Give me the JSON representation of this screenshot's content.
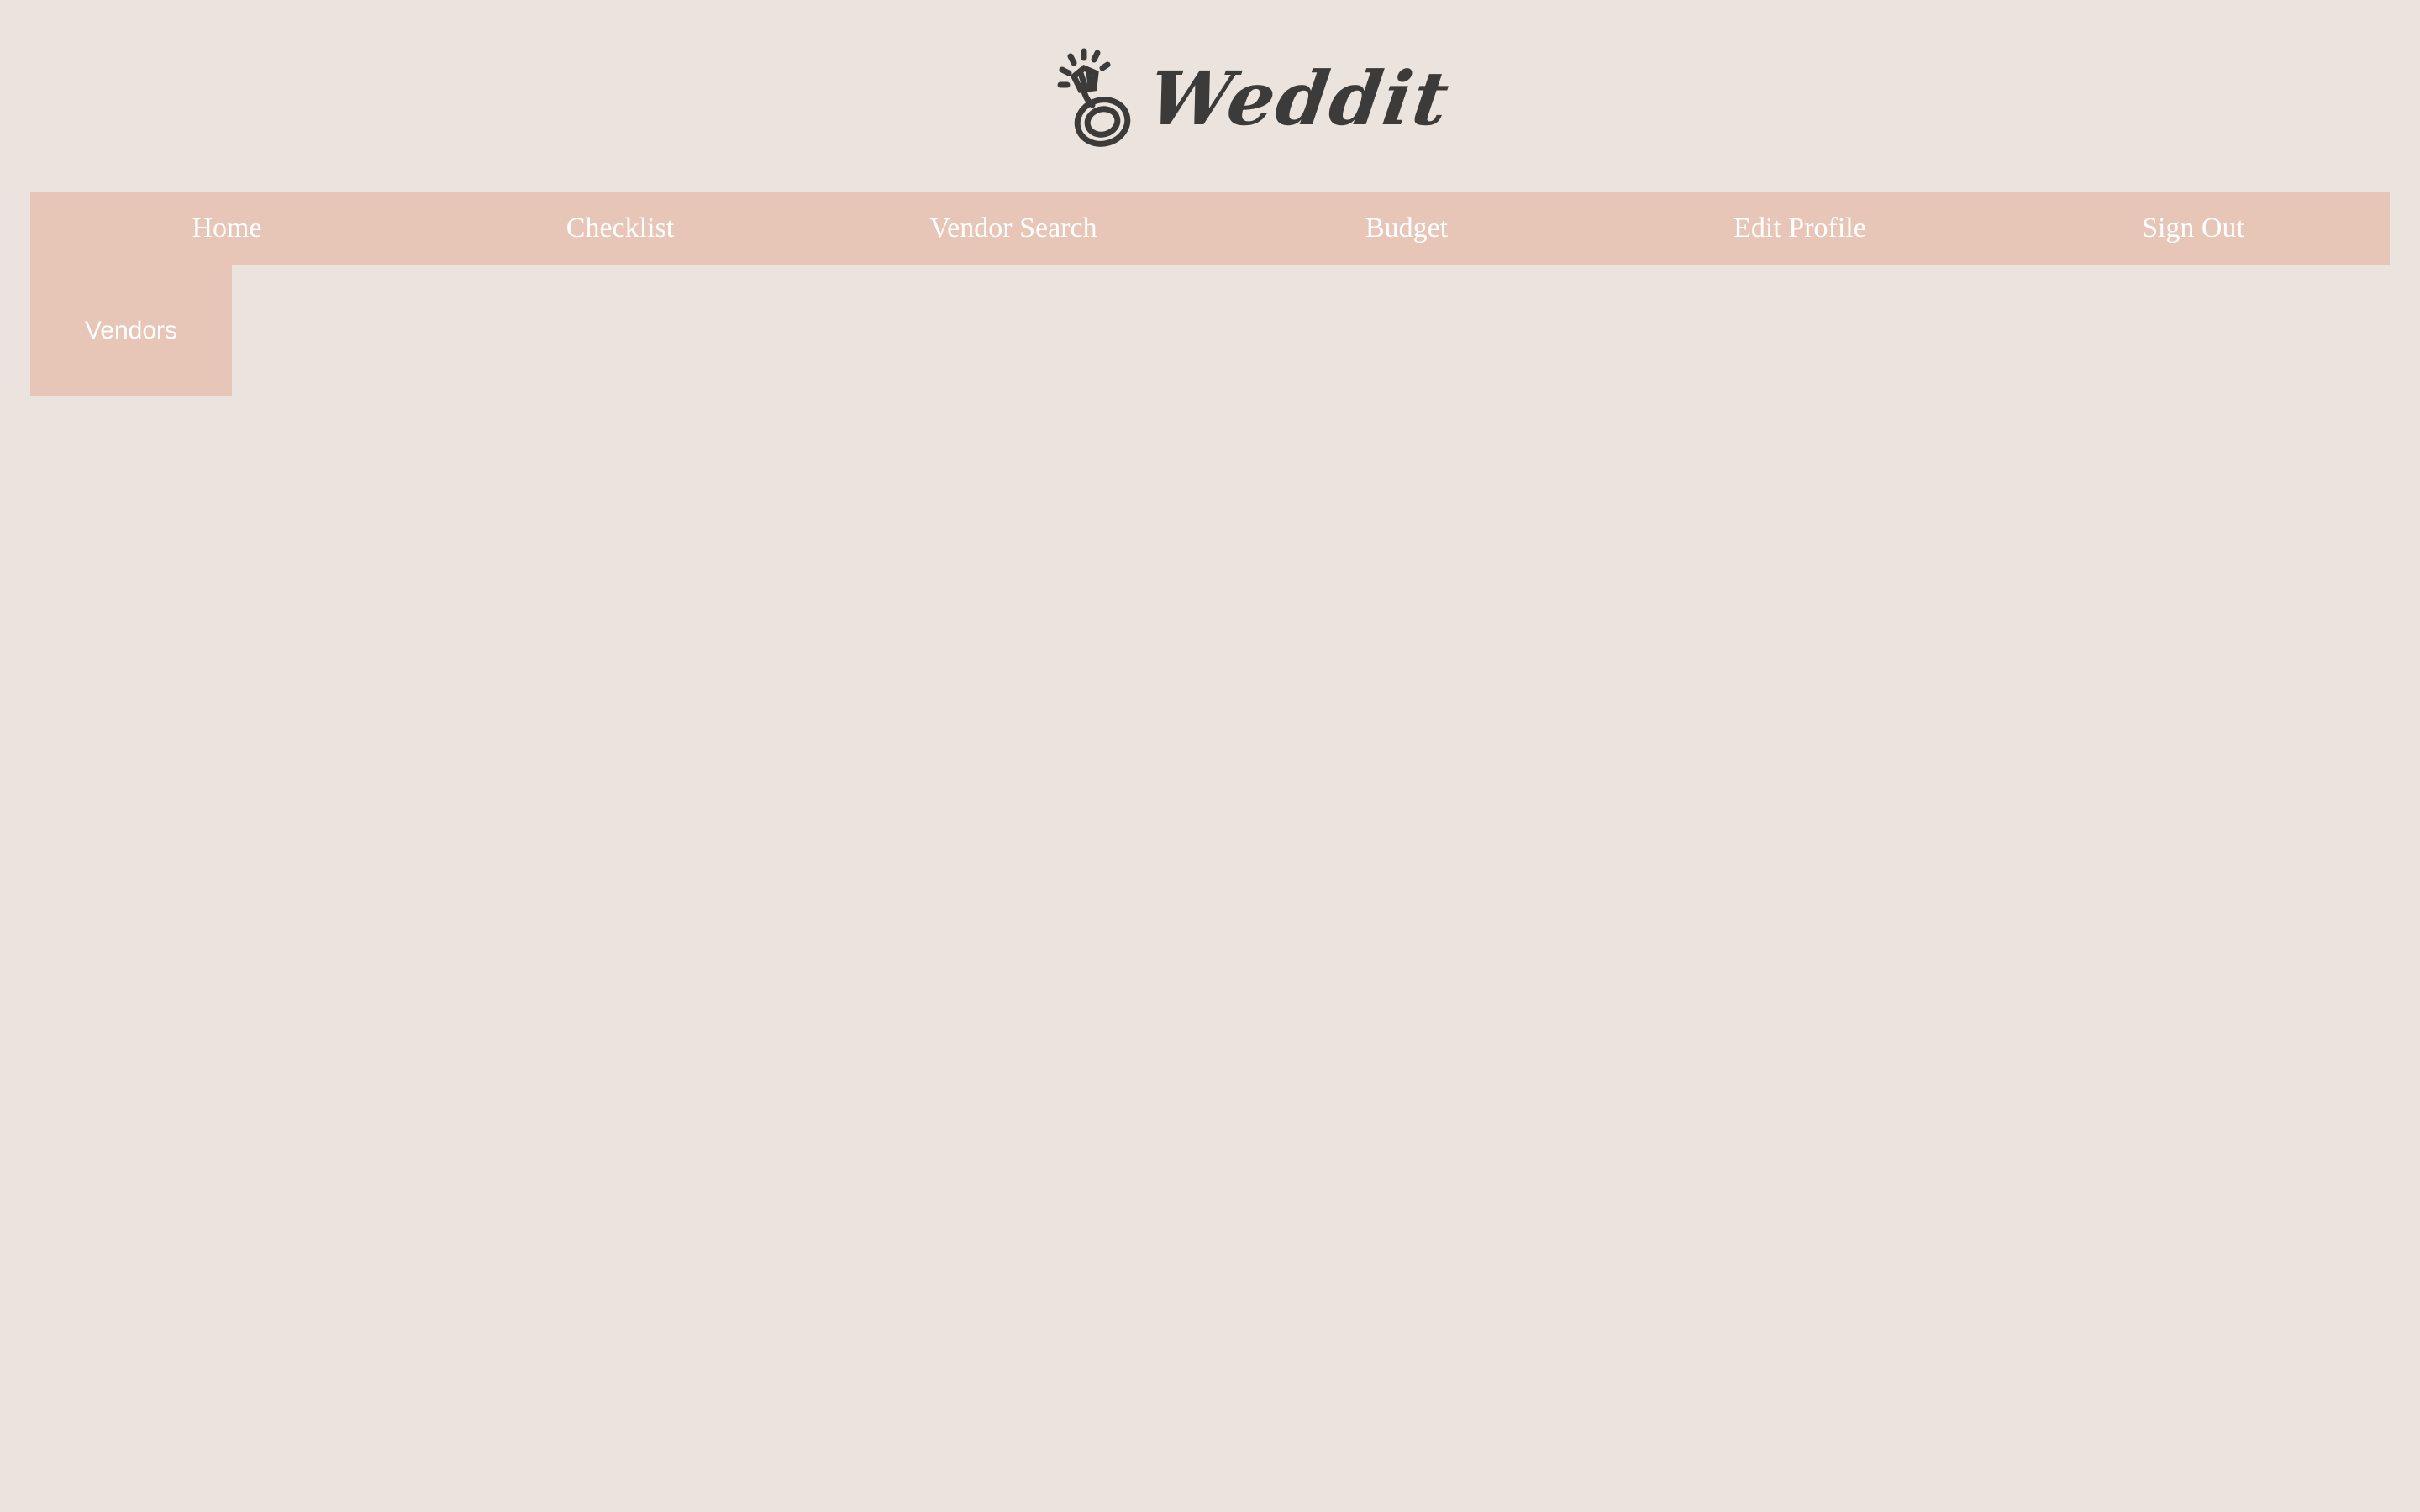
{
  "header": {
    "logo_text": "Weddit",
    "logo_icon": "engagement-ring-icon"
  },
  "navbar": {
    "items": [
      {
        "label": "Home"
      },
      {
        "label": "Checklist"
      },
      {
        "label": "Vendor Search"
      },
      {
        "label": "Budget"
      },
      {
        "label": "Edit Profile"
      },
      {
        "label": "Sign Out"
      }
    ]
  },
  "dropdown": {
    "items": [
      {
        "label": "Vendors"
      }
    ]
  },
  "colors": {
    "background": "#ebe3de",
    "nav_bg": "#e7c6b8",
    "nav_text": "#ffffff",
    "logo": "#3d3b3a"
  }
}
